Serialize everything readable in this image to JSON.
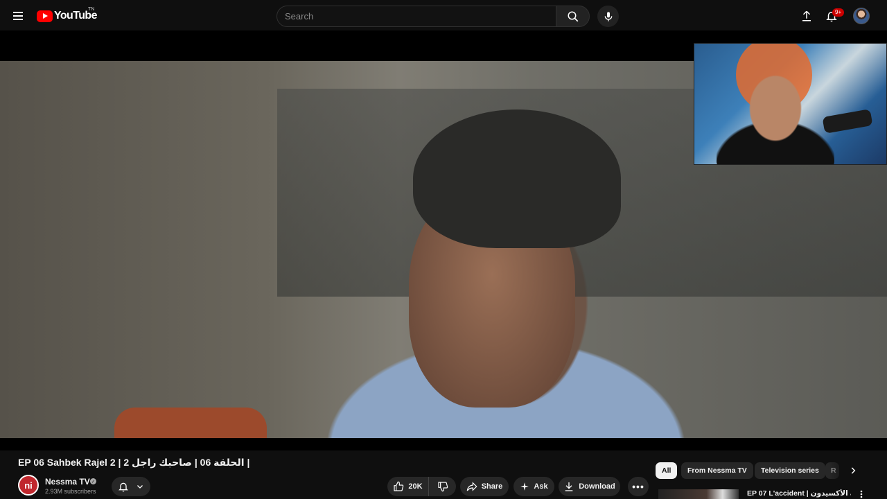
{
  "topbar": {
    "logo_text": "YouTube",
    "logo_tm": "TN",
    "search_placeholder": "Search",
    "notification_badge": "9+"
  },
  "video": {
    "title": "EP 06 Sahbek Rajel 2 | الحلقة 06 | صاحبك راجل 2 |"
  },
  "channel": {
    "name": "Nessma TV",
    "subscribers": "2.93M subscribers",
    "avatar_glyph": "ni"
  },
  "actions": {
    "like_count": "20K",
    "share_label": "Share",
    "ask_label": "Ask",
    "download_label": "Download",
    "more_label": "•••"
  },
  "chips": {
    "all": "All",
    "from_channel": "From Nessma TV",
    "television": "Television series",
    "partial": "R"
  },
  "recommendation": {
    "title": "EP 07 L'accident | الحلقة الأكسيدون"
  },
  "colors": {
    "background": "#0f0f0f",
    "accent": "#ff0000",
    "badge": "#cc0000"
  },
  "icons": [
    "menu-icon",
    "search-icon",
    "mic-icon",
    "upload-icon",
    "bell-icon",
    "chevron-down-icon",
    "like-icon",
    "dislike-icon",
    "share-icon",
    "sparkle-icon",
    "download-icon",
    "chevron-right-icon",
    "more-vert-icon"
  ]
}
